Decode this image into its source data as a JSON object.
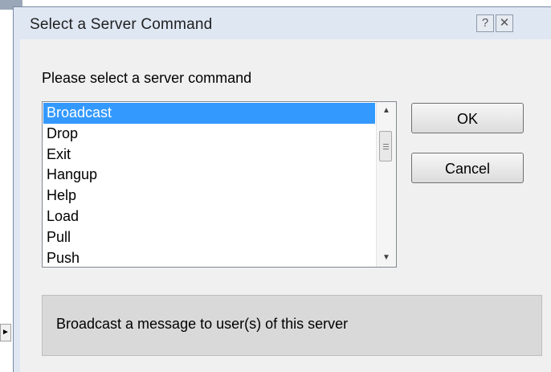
{
  "dialog": {
    "title": "Select a Server Command",
    "help_glyph": "?",
    "close_glyph": "✕"
  },
  "prompt": "Please select a server command",
  "commands": {
    "selected": "Broadcast",
    "items": [
      "Broadcast",
      "Drop",
      "Exit",
      "Hangup",
      "Help",
      "Load",
      "Pull",
      "Push"
    ]
  },
  "buttons": {
    "ok_label": "OK",
    "cancel_label": "Cancel"
  },
  "description": "Broadcast a message to user(s) of this server",
  "scrollbar": {
    "up_glyph": "▲",
    "down_glyph": "▼"
  },
  "background": {
    "scroll_right_glyph": "►"
  },
  "colors": {
    "selection": "#3399ff",
    "dialog_frame": "#dfe7f3",
    "client_background": "#f0f0f0",
    "description_panel": "#d9d9d9"
  }
}
